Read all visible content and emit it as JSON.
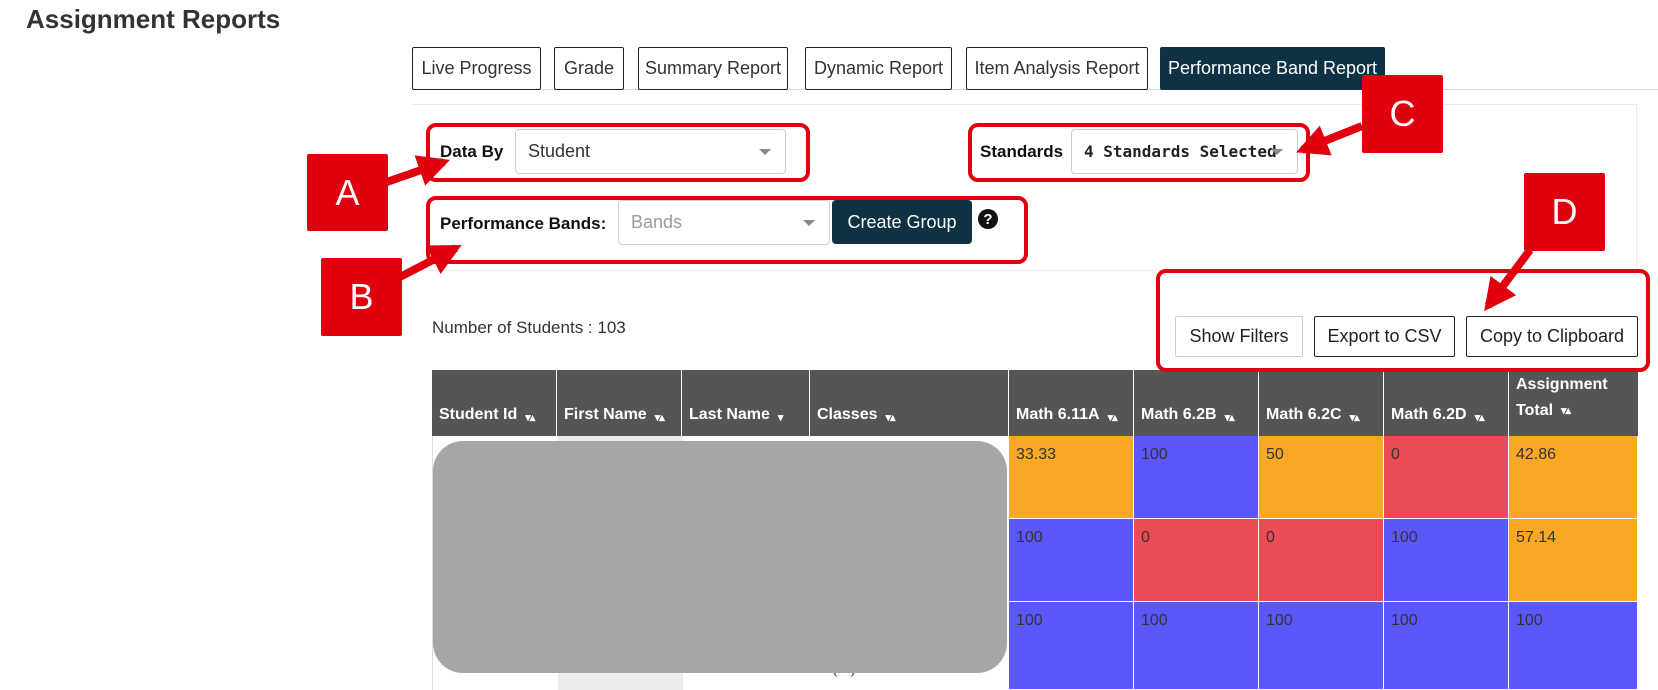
{
  "page_title": "Assignment Reports",
  "tabs": [
    {
      "label": "Live Progress"
    },
    {
      "label": "Grade"
    },
    {
      "label": "Summary Report"
    },
    {
      "label": "Dynamic Report"
    },
    {
      "label": "Item Analysis Report"
    },
    {
      "label": "Performance Band Report",
      "active": true
    }
  ],
  "filters": {
    "data_by_label": "Data By",
    "data_by_value": "Student",
    "standards_label": "Standards",
    "standards_value": "4 Standards Selected",
    "bands_label": "Performance Bands:",
    "bands_placeholder": "Bands",
    "create_group": "Create Group",
    "help_icon": "?"
  },
  "student_count": "Number of Students : 103",
  "actions": {
    "show_filters": "Show Filters",
    "export_csv": "Export to CSV",
    "copy_clipboard": "Copy to Clipboard"
  },
  "table": {
    "headers": [
      "Student Id",
      "First Name",
      "Last Name",
      "Classes",
      "Math 6.11A",
      "Math 6.2B",
      "Math 6.2C",
      "Math 6.2D",
      "Assignment",
      "Total"
    ],
    "sort_glyph": "▾▴",
    "sort_down_glyph": "▾",
    "rows": [
      [
        "33.33",
        "100",
        "50",
        "0",
        "42.86"
      ],
      [
        "100",
        "0",
        "0",
        "100",
        "57.14"
      ],
      [
        "100",
        "100",
        "100",
        "100",
        "100"
      ]
    ],
    "row_colors": [
      [
        "orange",
        "blue",
        "orange",
        "red",
        "orange"
      ],
      [
        "blue",
        "red",
        "red",
        "blue",
        "orange"
      ],
      [
        "blue",
        "blue",
        "blue",
        "blue",
        "blue"
      ]
    ],
    "partial_text": "(...)"
  },
  "annotations": {
    "a": "A",
    "b": "B",
    "c": "C",
    "d": "D"
  },
  "colors": {
    "orange": "#f9a826",
    "blue": "#5b57fb",
    "red": "#ea4b55",
    "annotation": "#e0000e",
    "primary": "#0e3244"
  }
}
